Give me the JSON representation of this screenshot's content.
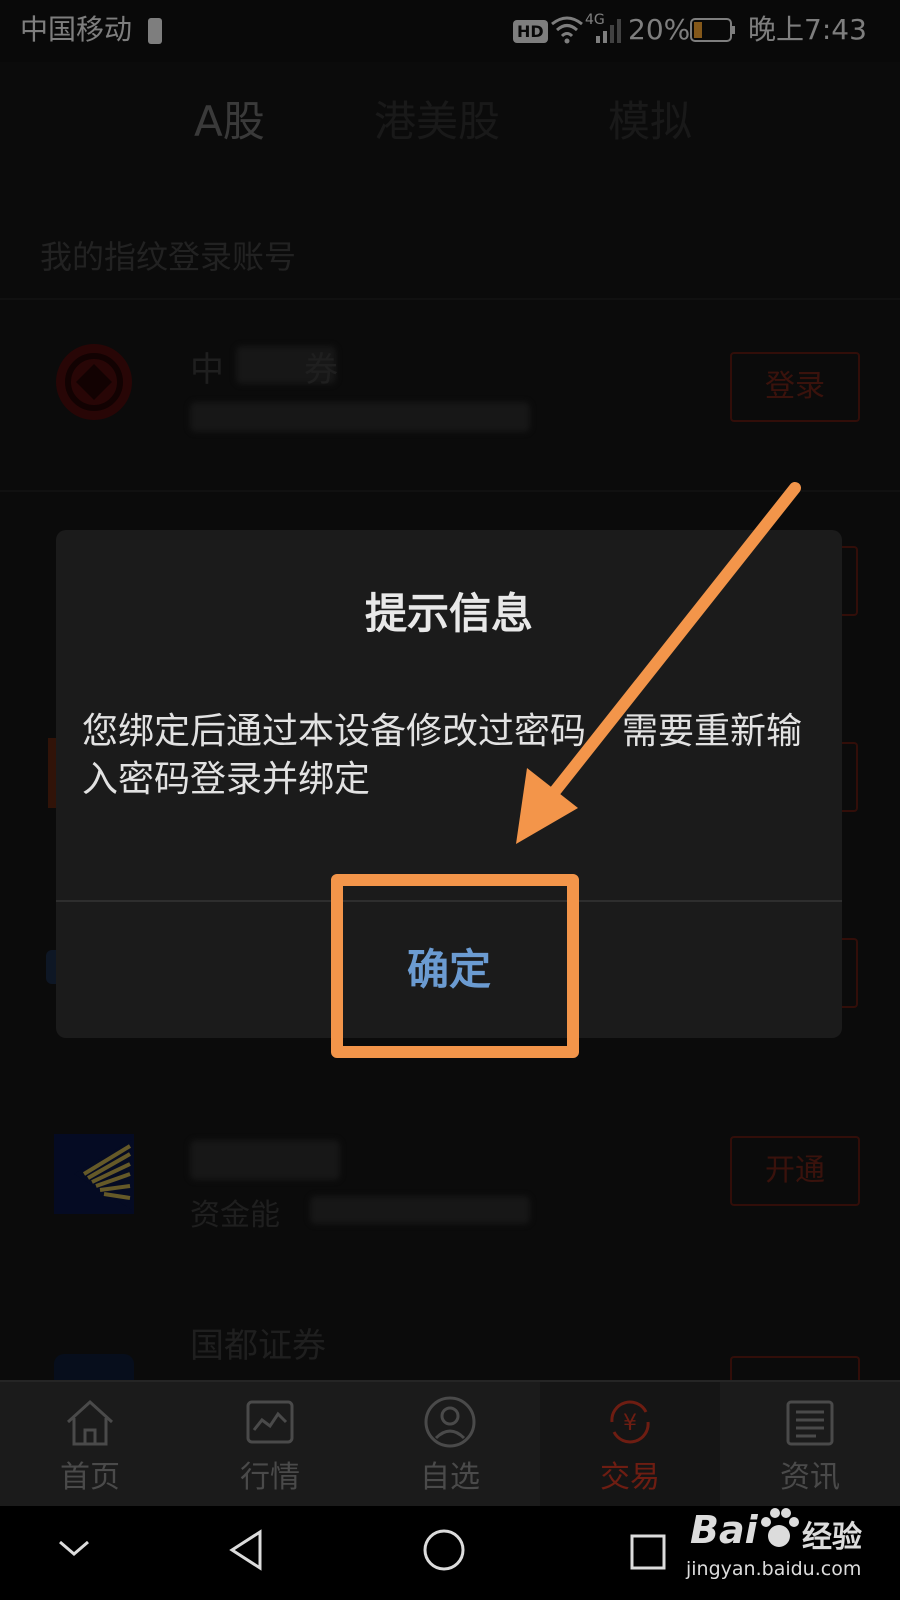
{
  "status": {
    "carrier": "中国移动",
    "hd": "HD",
    "network": "4G",
    "battery": "20%",
    "time": "晚上7:43"
  },
  "tabs": [
    {
      "label": "A股",
      "active": true
    },
    {
      "label": "港美股",
      "active": false
    },
    {
      "label": "模拟",
      "active": false
    }
  ],
  "section_title": "我的指纹登录账号",
  "brokers": [
    {
      "name": "中",
      "name_blurred_suffix": "券",
      "action": "登录"
    },
    {
      "name": "",
      "action": ""
    },
    {
      "name": "",
      "action": ""
    },
    {
      "name": "",
      "action": ""
    },
    {
      "name": "",
      "sub": "资金能",
      "action": "开通"
    },
    {
      "name": "国都证券",
      "action": ""
    }
  ],
  "dialog": {
    "title": "提示信息",
    "message": "您绑定后通过本设备修改过密码，需要重新输入密码登录并绑定",
    "ok": "确定"
  },
  "bottom_nav": [
    {
      "label": "首页",
      "icon": "home-icon",
      "active": false
    },
    {
      "label": "行情",
      "icon": "chart-icon",
      "active": false
    },
    {
      "label": "自选",
      "icon": "person-icon",
      "active": false
    },
    {
      "label": "交易",
      "icon": "yuan-exchange-icon",
      "active": true
    },
    {
      "label": "资讯",
      "icon": "news-icon",
      "active": false
    }
  ],
  "watermark": {
    "brand": "Bai",
    "brand2": "经验",
    "url": "jingyan.baidu.com"
  },
  "colors": {
    "accent_red": "#6e1d12",
    "dialog_ok_blue": "#6b9bd1",
    "highlight_orange": "#f3954a"
  }
}
